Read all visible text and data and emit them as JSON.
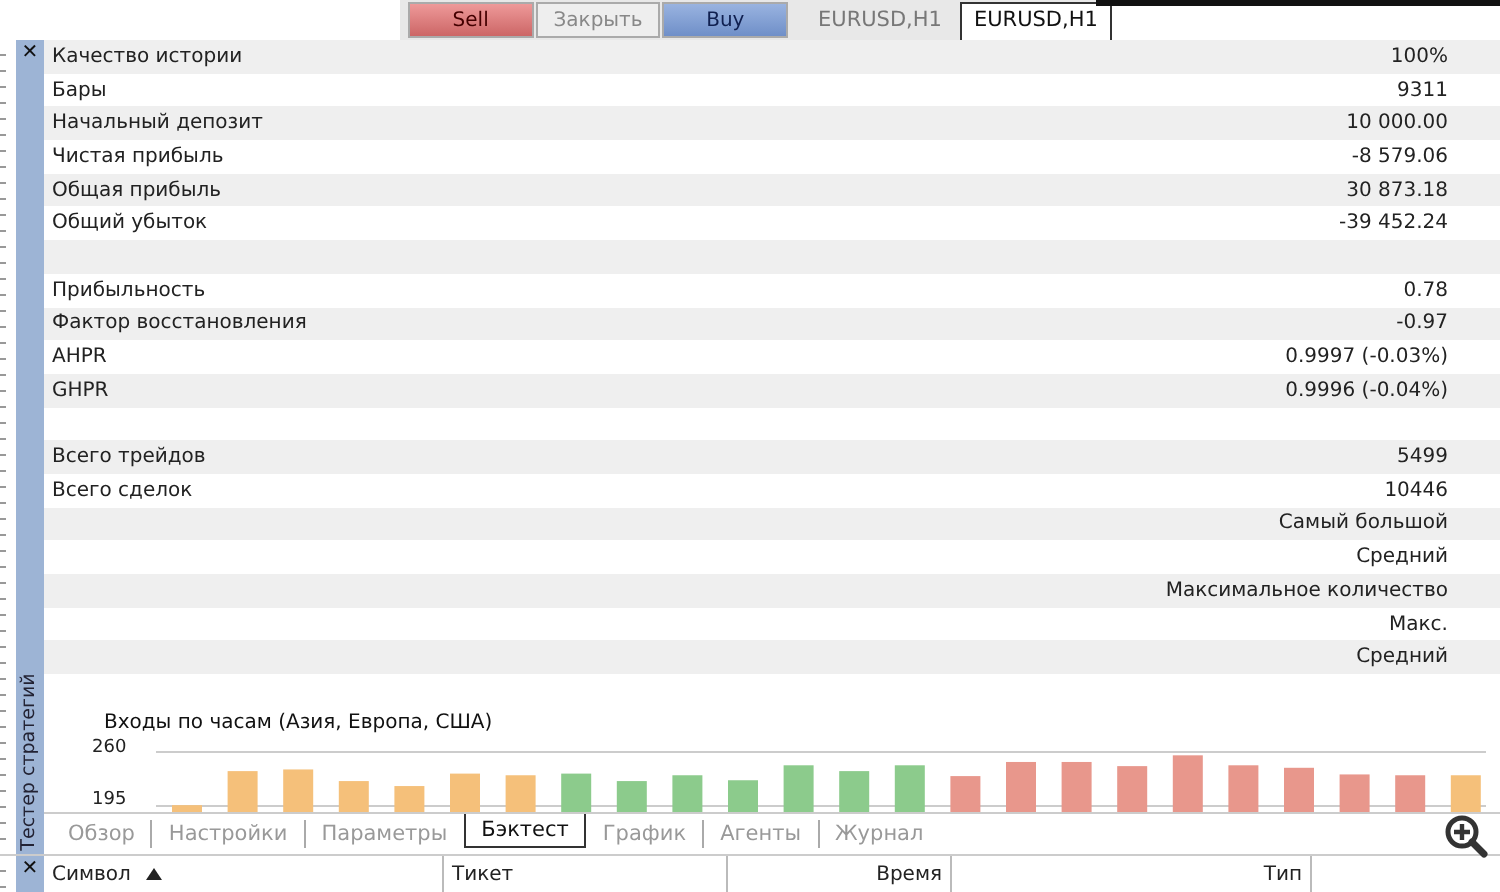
{
  "toolbar": {
    "buttons": [
      {
        "label": "Sell",
        "kind": "sell"
      },
      {
        "label": "Закрыть",
        "kind": "close"
      },
      {
        "label": "Buy",
        "kind": "buy"
      }
    ]
  },
  "chart_tabs": [
    {
      "label": "EURUSD,H1",
      "selected": false
    },
    {
      "label": "EURUSD,H1",
      "selected": true
    }
  ],
  "panel": {
    "title": "Тестер стратегий",
    "close_icon": "✕"
  },
  "stat_groups": [
    {
      "rows": [
        {
          "label": "Качество истории",
          "value": "100%"
        },
        {
          "label": "Бары",
          "value": "9311"
        },
        {
          "label": "Начальный депозит",
          "value": "10 000.00"
        },
        {
          "label": "Чистая прибыль",
          "value": "-8 579.06"
        },
        {
          "label": "Общая прибыль",
          "value": "30 873.18"
        },
        {
          "label": "Общий убыток",
          "value": "-39 452.24"
        }
      ]
    },
    {
      "rows": [
        {
          "label": "Прибыльность",
          "value": "0.78"
        },
        {
          "label": "Фактор восстановления",
          "value": "-0.97"
        },
        {
          "label": "AHPR",
          "value": "0.9997 (-0.03%)"
        },
        {
          "label": "GHPR",
          "value": "0.9996 (-0.04%)"
        }
      ]
    },
    {
      "rows": [
        {
          "label": "Всего трейдов",
          "value": "5499"
        },
        {
          "label": "Всего сделок",
          "value": "10446"
        },
        {
          "value": "Самый большой"
        },
        {
          "value": "Средний"
        },
        {
          "value": "Максимальное количество"
        },
        {
          "value": "Макс."
        },
        {
          "value": "Средний"
        }
      ]
    }
  ],
  "chart_data": {
    "type": "bar",
    "title": "Входы по часам (Азия, Европа, США)",
    "ylim": [
      195,
      260
    ],
    "yticks": [
      195,
      260
    ],
    "series": [
      {
        "color": "#f5c07a",
        "values": [
          196,
          237,
          239,
          225,
          219,
          234,
          232,
          null,
          null,
          null,
          null,
          null,
          null,
          null,
          null,
          null,
          null,
          null,
          null,
          null,
          null,
          null,
          null,
          232
        ]
      },
      {
        "color": "#8ccb8c",
        "values": [
          null,
          null,
          null,
          null,
          null,
          null,
          null,
          234,
          225,
          232,
          226,
          244,
          237,
          244,
          null,
          null,
          null,
          null,
          null,
          null,
          null,
          null,
          null,
          null
        ]
      },
      {
        "color": "#e8978c",
        "values": [
          null,
          null,
          null,
          null,
          null,
          null,
          null,
          null,
          null,
          null,
          null,
          null,
          null,
          null,
          231,
          248,
          248,
          243,
          256,
          244,
          241,
          233,
          232,
          null
        ]
      }
    ]
  },
  "tabs": [
    {
      "label": "Обзор",
      "selected": false
    },
    {
      "label": "Настройки",
      "selected": false
    },
    {
      "label": "Параметры",
      "selected": false
    },
    {
      "label": "Бэктест",
      "selected": true
    },
    {
      "label": "График",
      "selected": false
    },
    {
      "label": "Агенты",
      "selected": false
    },
    {
      "label": "Журнал",
      "selected": false
    }
  ],
  "table_close_icon": "✕",
  "columns": [
    {
      "label": "Символ",
      "sorted": true
    },
    {
      "label": "Тикет",
      "sorted": false
    },
    {
      "label": "Время",
      "sorted": false
    },
    {
      "label": "Тип",
      "sorted": false
    }
  ]
}
